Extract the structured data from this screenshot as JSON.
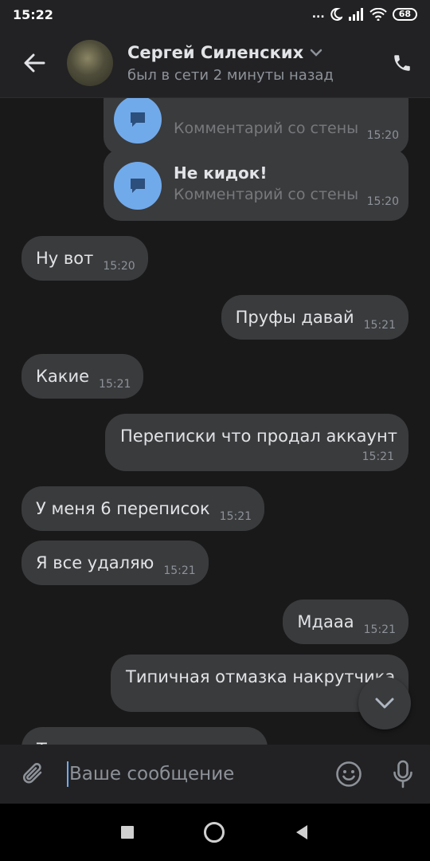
{
  "status_bar": {
    "time": "15:22",
    "dots": "...",
    "battery": "68"
  },
  "header": {
    "contact_name": "Сергей Силенских",
    "last_seen": "был в сети 2 минуты назад"
  },
  "cards": [
    {
      "title": "",
      "subtitle": "Комментарий со стены",
      "time": "15:20"
    },
    {
      "title": "Не кидок!",
      "subtitle": "Комментарий со стены",
      "time": "15:20"
    }
  ],
  "messages": [
    {
      "text": "Ну вот",
      "time": "15:20",
      "side": "in"
    },
    {
      "text": "Пруфы давай",
      "time": "15:21",
      "side": "out"
    },
    {
      "text": "Какие",
      "time": "15:21",
      "side": "in"
    },
    {
      "text": "Переписки что продал аккаунт",
      "time": "15:21",
      "side": "out"
    },
    {
      "text": "У меня 6 переписок",
      "time": "15:21",
      "side": "in"
    },
    {
      "text": "Я все удаляю",
      "time": "15:21",
      "side": "in"
    },
    {
      "text": "Мдааа",
      "time": "15:21",
      "side": "out"
    },
    {
      "text": "Типичная отмазка накрутчика",
      "time": "",
      "side": "out"
    },
    {
      "text": "Т",
      "time": "",
      "side": "in"
    }
  ],
  "composer": {
    "placeholder": "Ваше сообщение"
  }
}
